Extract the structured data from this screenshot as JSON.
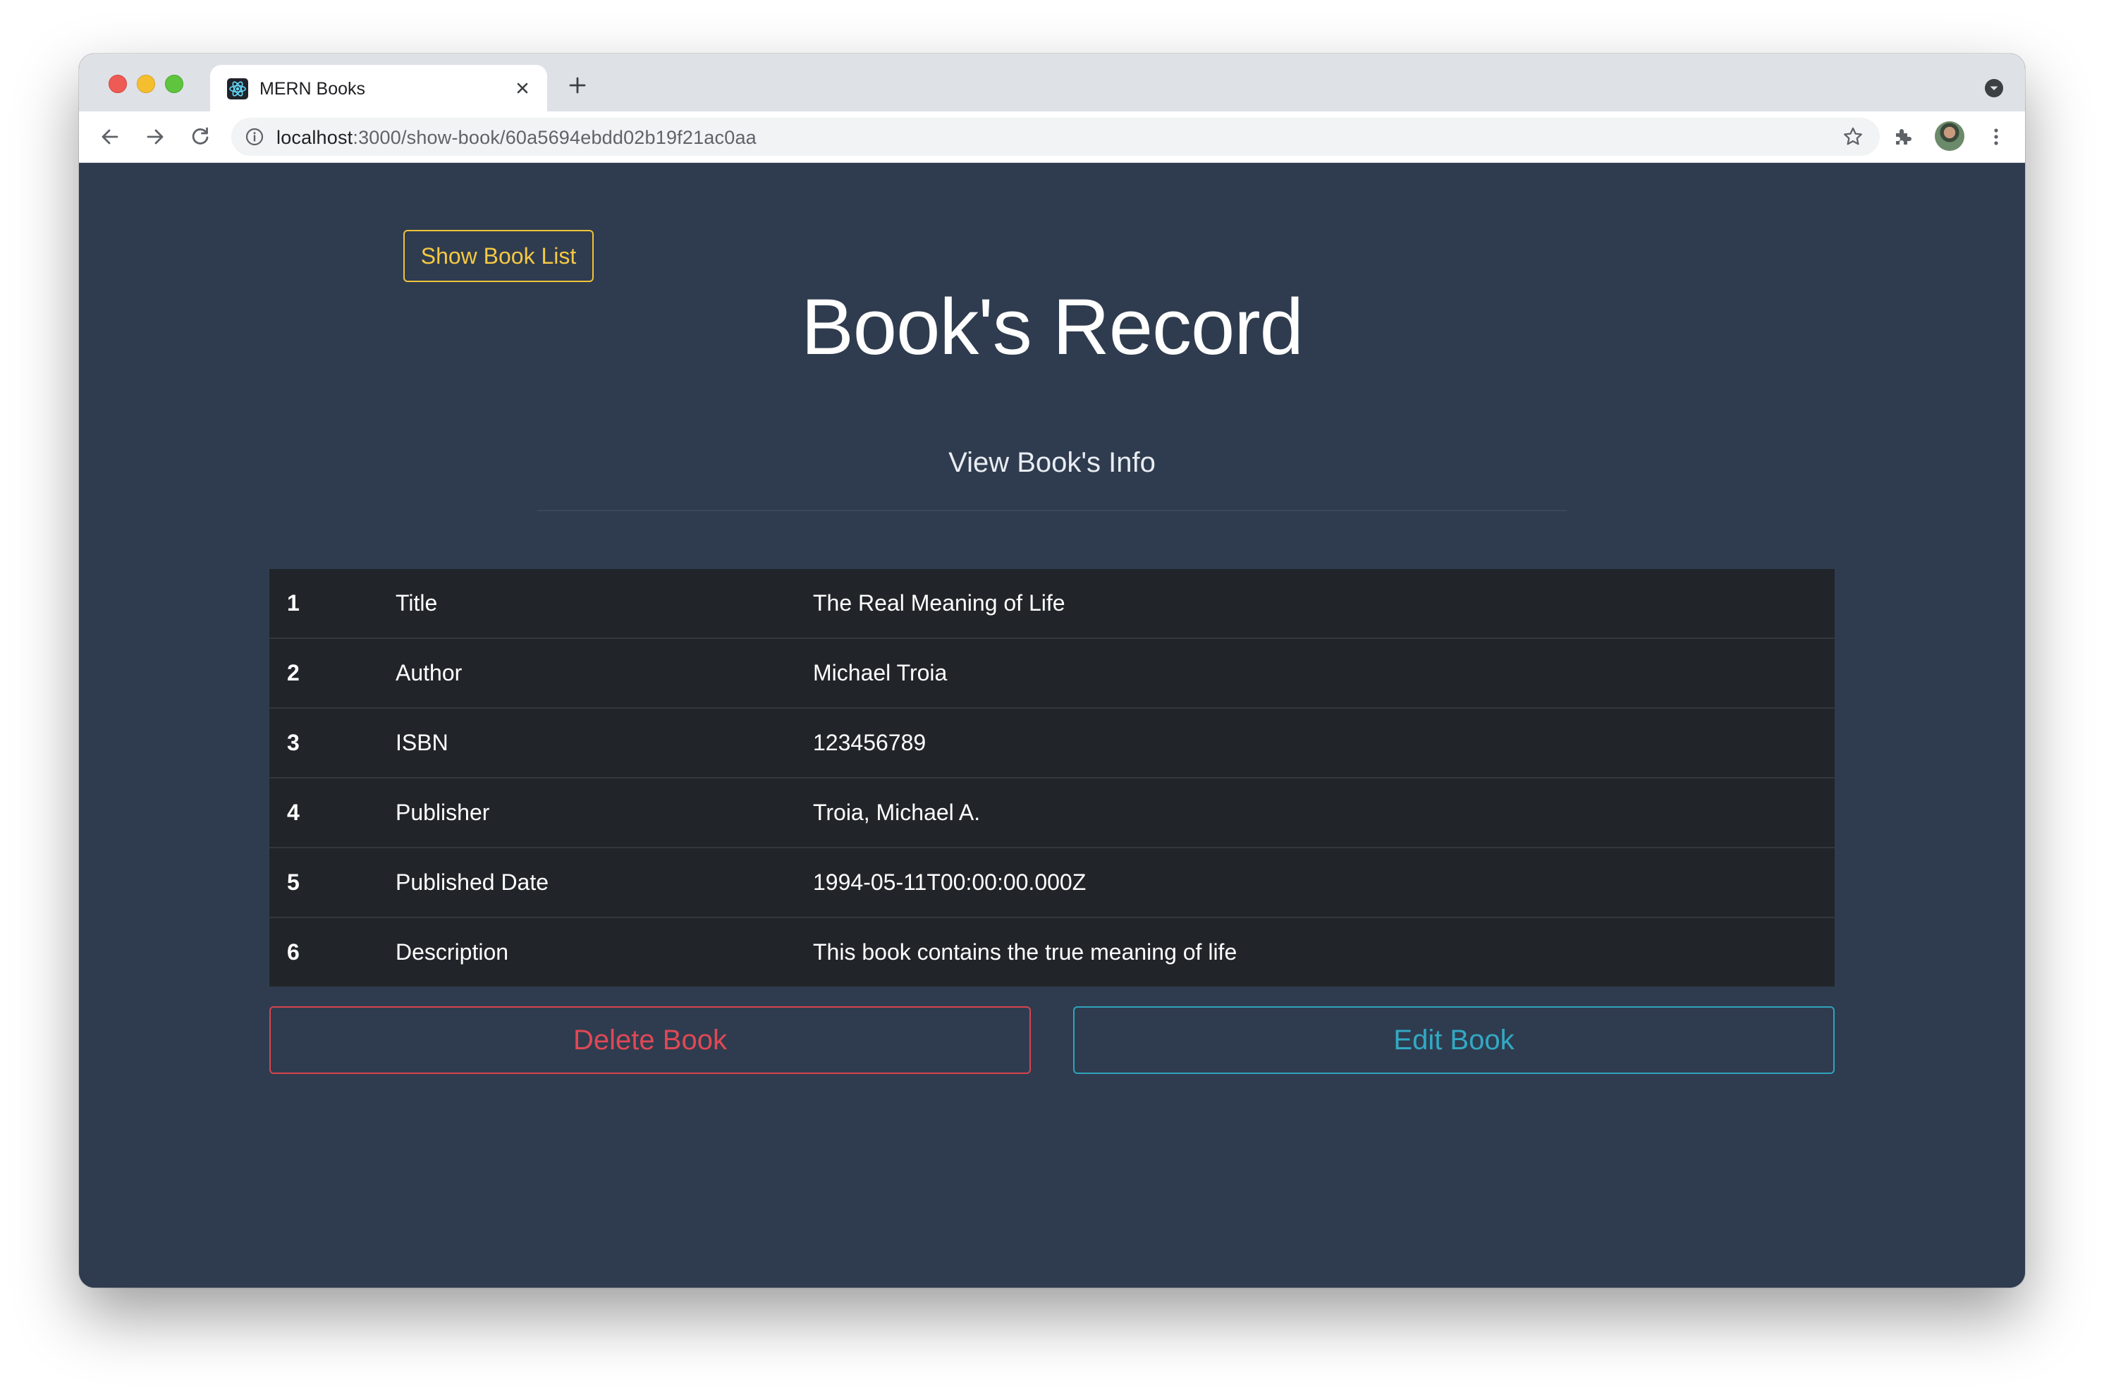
{
  "browser": {
    "tab_title": "MERN Books",
    "url_host": "localhost",
    "url_path": ":3000/show-book/60a5694ebdd02b19f21ac0aa"
  },
  "page": {
    "show_list_button": "Show Book List",
    "title": "Book's Record",
    "subtitle": "View Book's Info",
    "rows": [
      {
        "num": "1",
        "field": "Title",
        "value": "The Real Meaning of Life"
      },
      {
        "num": "2",
        "field": "Author",
        "value": "Michael Troia"
      },
      {
        "num": "3",
        "field": "ISBN",
        "value": "123456789"
      },
      {
        "num": "4",
        "field": "Publisher",
        "value": "Troia, Michael A."
      },
      {
        "num": "5",
        "field": "Published Date",
        "value": "1994-05-11T00:00:00.000Z"
      },
      {
        "num": "6",
        "field": "Description",
        "value": "This book contains the true meaning of life"
      }
    ],
    "delete_button": "Delete Book",
    "edit_button": "Edit Book"
  },
  "colors": {
    "page_background": "#2f3c4f",
    "table_background": "#212529",
    "warning": "#f5c842",
    "danger": "#e04856",
    "info": "#32a9c4"
  },
  "icons": {
    "favicon": "react-icon",
    "tab_close": "close-icon",
    "new_tab": "plus-icon",
    "tab_search": "tab-search-icon",
    "back": "arrow-left-icon",
    "forward": "arrow-right-icon",
    "reload": "reload-icon",
    "site_info": "info-icon",
    "bookmark": "star-icon",
    "extensions": "puzzle-icon",
    "menu": "kebab-icon"
  }
}
